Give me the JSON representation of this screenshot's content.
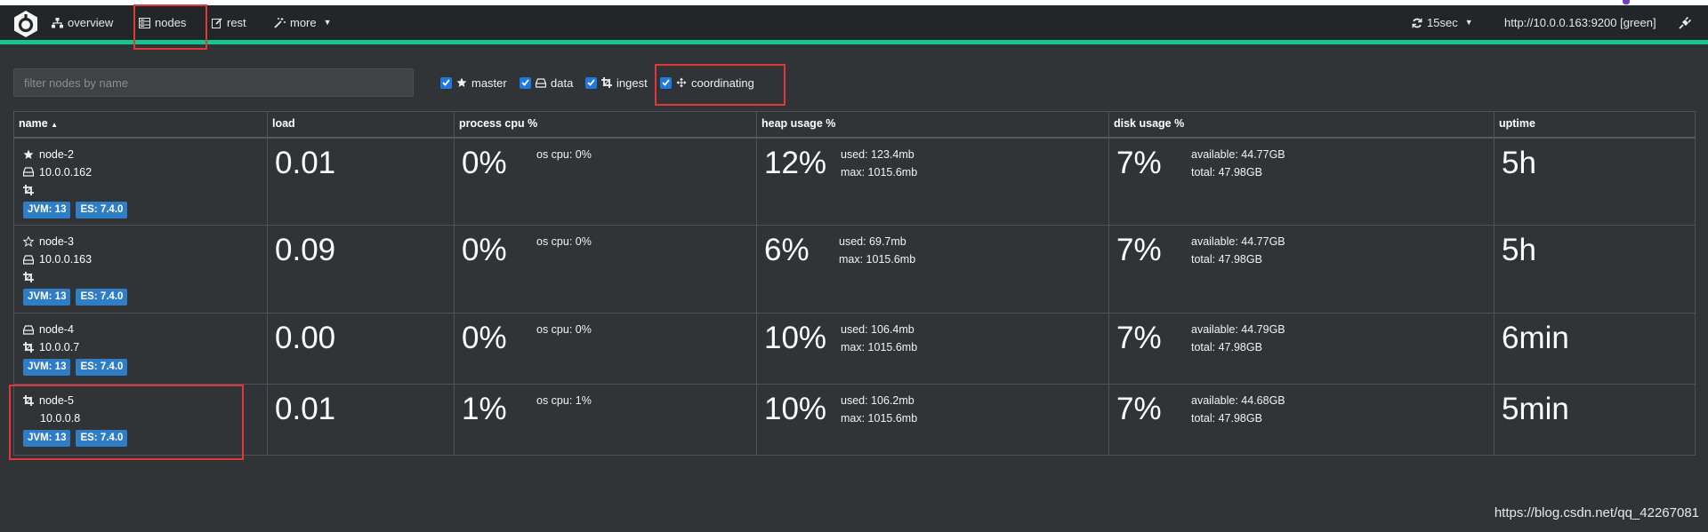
{
  "navbar": {
    "items": [
      {
        "label": "overview",
        "icon": "sitemap-icon"
      },
      {
        "label": "nodes",
        "icon": "server-icon"
      },
      {
        "label": "rest",
        "icon": "edit-icon"
      },
      {
        "label": "more",
        "icon": "magic-wand-icon"
      }
    ],
    "refresh": "15sec",
    "cluster": "http://10.0.0.163:9200 [green]",
    "accent_color": "#14c691"
  },
  "filter": {
    "placeholder": "filter nodes by name",
    "value": "",
    "roles": [
      {
        "label": "master",
        "checked": true
      },
      {
        "label": "data",
        "checked": true
      },
      {
        "label": "ingest",
        "checked": true
      },
      {
        "label": "coordinating",
        "checked": true
      }
    ]
  },
  "table": {
    "headers": [
      "name",
      "load",
      "process cpu %",
      "heap usage %",
      "disk usage %",
      "uptime"
    ],
    "rows": [
      {
        "name": "node-2",
        "ip": "10.0.0.162",
        "roles_icons": [
          "star-filled-icon",
          "hdd-icon",
          "crop-icon"
        ],
        "jvm": "JVM: 13",
        "es": "ES: 7.4.0",
        "load": "0.01",
        "cpu": "0%",
        "os_cpu": "os cpu: 0%",
        "heap": "12%",
        "heap_used": "used: 123.4mb",
        "heap_max": "max: 1015.6mb",
        "disk": "7%",
        "disk_available": "available: 44.77GB",
        "disk_total": "total: 47.98GB",
        "uptime": "5h"
      },
      {
        "name": "node-3",
        "ip": "10.0.0.163",
        "roles_icons": [
          "star-outline-icon",
          "hdd-icon",
          "crop-icon"
        ],
        "jvm": "JVM: 13",
        "es": "ES: 7.4.0",
        "load": "0.09",
        "cpu": "0%",
        "os_cpu": "os cpu: 0%",
        "heap": "6%",
        "heap_used": "used: 69.7mb",
        "heap_max": "max: 1015.6mb",
        "disk": "7%",
        "disk_available": "available: 44.77GB",
        "disk_total": "total: 47.98GB",
        "uptime": "5h"
      },
      {
        "name": "node-4",
        "ip": "10.0.0.7",
        "roles_icons": [
          "hdd-icon",
          "crop-icon"
        ],
        "jvm": "JVM: 13",
        "es": "ES: 7.4.0",
        "load": "0.00",
        "cpu": "0%",
        "os_cpu": "os cpu: 0%",
        "heap": "10%",
        "heap_used": "used: 106.4mb",
        "heap_max": "max: 1015.6mb",
        "disk": "7%",
        "disk_available": "available: 44.79GB",
        "disk_total": "total: 47.98GB",
        "uptime": "6min"
      },
      {
        "name": "node-5",
        "ip": "10.0.0.8",
        "roles_icons": [
          "crop-icon"
        ],
        "jvm": "JVM: 13",
        "es": "ES: 7.4.0",
        "load": "0.01",
        "cpu": "1%",
        "os_cpu": "os cpu: 1%",
        "heap": "10%",
        "heap_used": "used: 106.2mb",
        "heap_max": "max: 1015.6mb",
        "disk": "7%",
        "disk_available": "available: 44.68GB",
        "disk_total": "total: 47.98GB",
        "uptime": "5min"
      }
    ]
  },
  "watermark": "https://blog.csdn.net/qq_42267081"
}
